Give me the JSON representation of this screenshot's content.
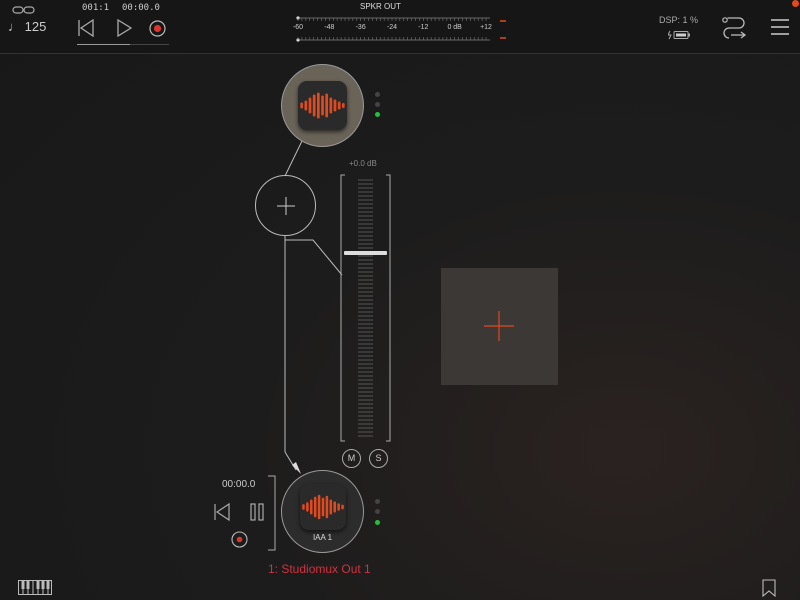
{
  "topbar": {
    "tempo": "♩ 125",
    "position": "001:1",
    "time": "00:00.0",
    "meter_title": "SPKR OUT",
    "meter_ticks": [
      "-60",
      "-48",
      "-36",
      "-24",
      "-12",
      "0 dB",
      "+12"
    ],
    "dsp": "DSP:  1 %"
  },
  "mixer": {
    "fader_db": "+0.0 dB",
    "fader_level": 0.29,
    "mute_label": "M",
    "solo_label": "S"
  },
  "player": {
    "time": "00:00.0",
    "node_label": "IAA 1",
    "output_label": "1: Studiomux Out 1"
  },
  "colors": {
    "accent": "#e04a1e",
    "record": "#e0332a",
    "green": "#22c23a",
    "output_label": "#d0323e"
  },
  "icons": [
    "link-icon",
    "rewind-icon",
    "play-icon",
    "record-icon",
    "battery-icon",
    "routing-icon",
    "menu-icon",
    "waveform-icon",
    "add-icon",
    "skip-back-icon",
    "pause-icon",
    "keyboard-icon",
    "bookmark-icon"
  ]
}
